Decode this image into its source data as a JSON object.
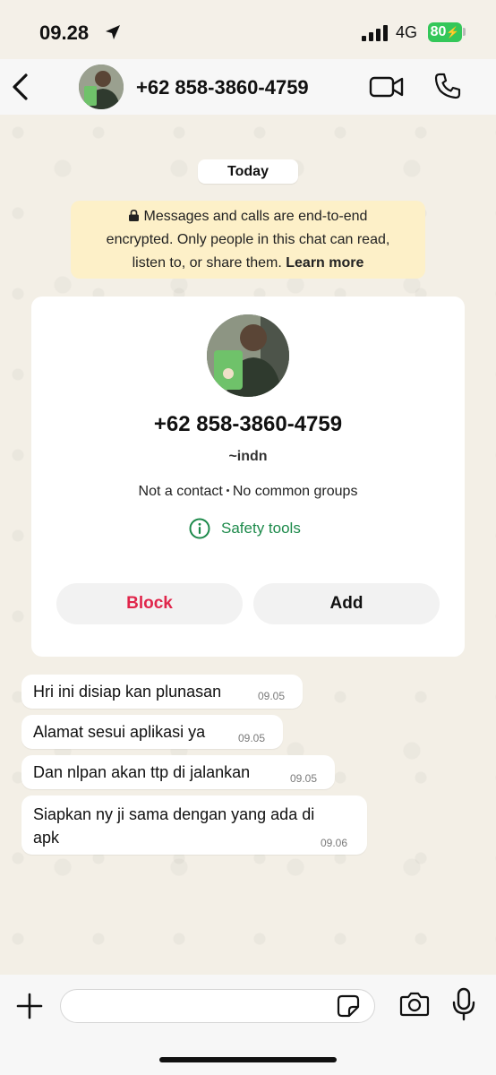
{
  "status_bar": {
    "time": "09.28",
    "network": "4G",
    "battery": "80"
  },
  "header": {
    "title": "+62 858-3860-4759"
  },
  "date_pill": "Today",
  "notice": {
    "line1": "Messages and calls are end-to-end",
    "line2": "encrypted. Only people in this chat can read,",
    "line3_text": "listen to, or share them.",
    "learn_more": "Learn more"
  },
  "card": {
    "phone": "+62 858-3860-4759",
    "nickname": "~indn",
    "not_contact": "Not a contact",
    "common_groups": "No common groups",
    "safety_tools": "Safety tools",
    "block_label": "Block",
    "add_label": "Add"
  },
  "messages": [
    {
      "text": "Hri ini disiap kan plunasan",
      "time": "09.05"
    },
    {
      "text": "Alamat sesui aplikasi ya",
      "time": "09.05"
    },
    {
      "text": "Dan nlpan akan ttp di jalankan",
      "time": "09.05"
    },
    {
      "text_line1": "Siapkan ny ji sama dengan yang ada di",
      "text_line2": "apk",
      "time": "09.06"
    }
  ],
  "colors": {
    "accent_green": "#1d8a4b",
    "block_red": "#e0264b",
    "notice_bg": "#fdf0c8",
    "battery_green": "#34c759"
  }
}
